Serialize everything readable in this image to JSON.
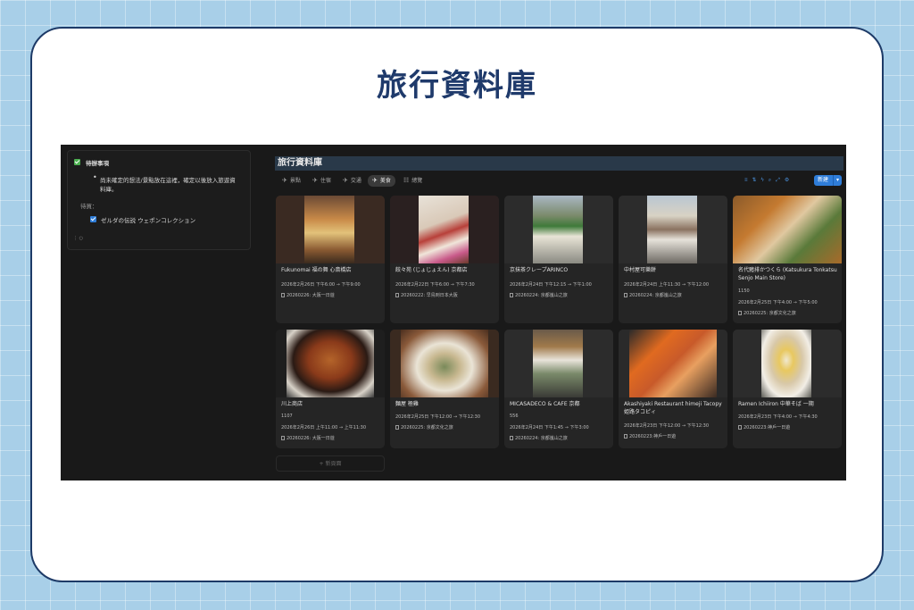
{
  "header": {
    "title": "旅行資料庫"
  },
  "todo": {
    "heading": "待辦事項",
    "bullet": "尚未確定的想法/景點放在這裡，確定以後放入旅遊資料庫。",
    "pending_label": "待買：",
    "item": "ゼルダの伝説 ウェポンコレクション"
  },
  "database": {
    "title": "旅行資料庫",
    "tabs": [
      {
        "label": "景點",
        "icon": "plane-icon"
      },
      {
        "label": "住宿",
        "icon": "plane-icon"
      },
      {
        "label": "交通",
        "icon": "plane-icon"
      },
      {
        "label": "美食",
        "icon": "plane-icon"
      },
      {
        "label": "總覽",
        "icon": "table-icon"
      }
    ],
    "active_tab": "美食",
    "new_button": "新建",
    "add_page": "+ 新頁面",
    "cards": [
      {
        "title": "Fukunomai 福の舞 心斎橋店",
        "extra": "",
        "time": "2026年2月26日 下午6:00 → 下午9:00",
        "trip": "20260226: 大阪一日遊"
      },
      {
        "title": "餃々苑 (じょじょえん) 京都店",
        "extra": "",
        "time": "2026年2月22日 下午6:00 → 下午7:30",
        "trip": "20260222: 早鳥到日本大阪"
      },
      {
        "title": "京抹茶クレープARINCO",
        "extra": "",
        "time": "2026年2月24日 下午12:15 → 下午1:00",
        "trip": "20260224: 京都嵐山之旅"
      },
      {
        "title": "中村屋可樂餅",
        "extra": "",
        "time": "2026年2月24日 上午11:30 → 下午12:00",
        "trip": "20260224: 京都嵐山之旅"
      },
      {
        "title": "名代豬排かつくら (Katsukura Tonkatsu Senjo Main Store)",
        "extra": "1150",
        "time": "2026年2月25日 下午4:00 → 下午5:00",
        "trip": "20260225: 京都文化之旅"
      },
      {
        "title": "川上商店",
        "extra": "1107",
        "time": "2026年2月26日 上午11:00 → 上午11:30",
        "trip": "20260226: 大阪一日遊"
      },
      {
        "title": "麵屋 極雞",
        "extra": "",
        "time": "2026年2月25日 下午12:00 → 下午12:30",
        "trip": "20260225: 京都文化之旅"
      },
      {
        "title": "MICASADECO & CAFE 京都",
        "extra": "556",
        "time": "2026年2月24日 下午1:45 → 下午3:00",
        "trip": "20260224: 京都嵐山之旅"
      },
      {
        "title": "Akashiyaki Restaurant himeji Tacopy 姫路タコピィ",
        "extra": "",
        "time": "2026年2月23日 下午12:00 → 下午12:30",
        "trip": "20260223:神戶一日遊"
      },
      {
        "title": "Ramen Ichiiron 中華そば 一期",
        "extra": "",
        "time": "2026年2月23日 下午4:00 → 下午4:30",
        "trip": "20260223:神戶一日遊"
      }
    ]
  },
  "colors": {
    "accent": "#2f7dd8",
    "title_blue": "#1f3a6b",
    "frame": "#1d3a67"
  }
}
